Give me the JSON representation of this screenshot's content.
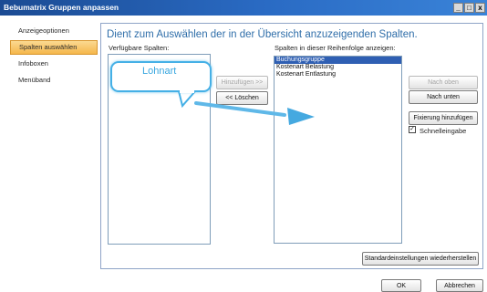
{
  "window": {
    "title": "Bebumatrix Gruppen anpassen",
    "controls": [
      "_",
      "□",
      "x"
    ]
  },
  "sidebar": {
    "items": [
      {
        "label": "Anzeigeoptionen"
      },
      {
        "label": "Spalten auswählen",
        "active": true
      },
      {
        "label": "Infoboxen"
      },
      {
        "label": "Menüband"
      }
    ]
  },
  "main": {
    "heading": "Dient zum Auswählen der in der Übersicht anzuzeigenden Spalten.",
    "available_label": "Verfügbare Spalten:",
    "order_label": "Spalten in dieser Reihenfolge anzeigen:",
    "add_button": "Hinzufügen >>",
    "remove_button": "<< Löschen",
    "ordered_columns": [
      "Buchungsgruppe",
      "Kostenart Belastung",
      "Kostenart Entlastung"
    ],
    "selected_index": 0,
    "move_up_button": "Nach oben",
    "move_down_button": "Nach unten",
    "add_fixation_button": "Fixierung hinzufügen",
    "quick_entry_checkbox": {
      "label": "Schnelleingabe",
      "checked": true,
      "mark": "✓"
    },
    "reset_button": "Standardeinstellungen wiederherstellen"
  },
  "annotation": {
    "callout_text": "Lohnart",
    "color": "#37a6df"
  },
  "footer": {
    "ok_button": "OK",
    "cancel_button": "Abbrechen"
  }
}
